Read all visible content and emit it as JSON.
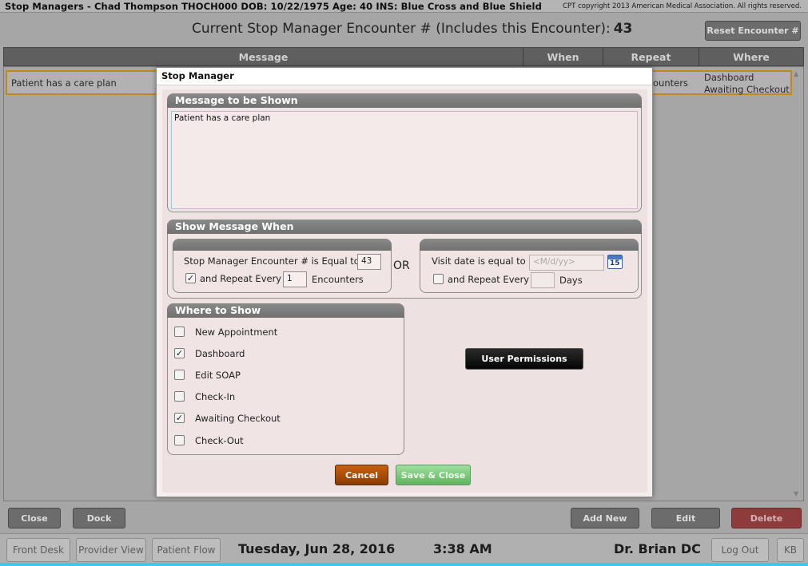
{
  "app": {
    "patient_line": "Stop Managers - Chad Thompson   THOCH000   DOB: 10/22/1975   Age: 40   INS: Blue Cross and Blue Shield",
    "copyright": "CPT copyright 2013 American Medical Association. All rights reserved.",
    "encounter_label": "Current Stop Manager Encounter # (Includes this Encounter):",
    "encounter_number": "43",
    "reset_button": "Reset Encounter #"
  },
  "grid": {
    "columns": [
      "Message",
      "When",
      "Repeat",
      "Where"
    ],
    "rows": [
      {
        "message": "Patient has a care plan",
        "repeat": "ounters",
        "where_line1": "Dashboard",
        "where_line2": "Awaiting Checkout"
      }
    ]
  },
  "actions": {
    "close": "Close",
    "dock": "Dock",
    "add_new": "Add New",
    "edit": "Edit",
    "delete": "Delete"
  },
  "footer": {
    "front_desk": "Front Desk",
    "provider_view": "Provider View",
    "patient_flow": "Patient Flow",
    "date": "Tuesday, Jun 28, 2016",
    "time": "3:38 AM",
    "doctor": "Dr. Brian DC",
    "log_out": "Log Out",
    "kb": "KB"
  },
  "modal": {
    "title": "Stop Manager",
    "message_group": {
      "header": "Message to be Shown",
      "text": "Patient has a care plan"
    },
    "when_group": {
      "header": "Show Message When",
      "encounter_label": "Stop Manager Encounter # is Equal to",
      "encounter_value": "43",
      "repeat_label": "and Repeat Every",
      "repeat_value": "1",
      "repeat_unit": "Encounters",
      "repeat_checked": true,
      "or_label": "OR",
      "visit_label": "Visit date is equal to",
      "visit_placeholder": "<M/d/yy>",
      "calendar_number": "15",
      "days_repeat_label": "and Repeat Every",
      "days_repeat_checked": false,
      "days_unit": "Days"
    },
    "where_group": {
      "header": "Where to Show",
      "items": [
        {
          "label": "New Appointment",
          "checked": false
        },
        {
          "label": "Dashboard",
          "checked": true
        },
        {
          "label": "Edit SOAP",
          "checked": false
        },
        {
          "label": "Check-In",
          "checked": false
        },
        {
          "label": "Awaiting Checkout",
          "checked": true
        },
        {
          "label": "Check-Out",
          "checked": false
        }
      ]
    },
    "user_permissions": "User Permissions",
    "cancel": "Cancel",
    "save_close": "Save & Close"
  },
  "colors": {
    "cancel": "#b05308",
    "save": "#7cc87c",
    "selected_row_border": "#c08a1a",
    "accent_strip": "#3ec8e6"
  }
}
